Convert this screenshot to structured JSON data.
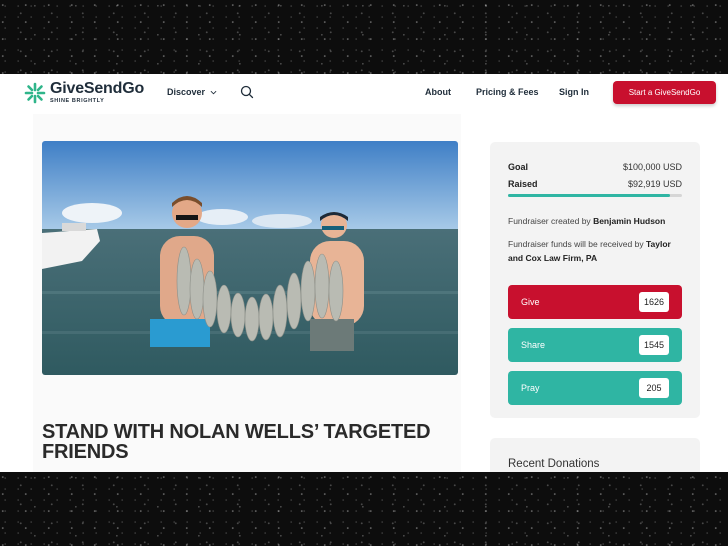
{
  "header": {
    "logo_name": "GiveSendGo",
    "logo_tagline": "SHINE BRIGHTLY",
    "discover_label": "Discover",
    "nav": [
      "About",
      "Pricing & Fees",
      "Sign In"
    ],
    "cta_label": "Start a GiveSendGo"
  },
  "campaign": {
    "title": "STAND WITH NOLAN WELLS’ TARGETED FRIENDS",
    "photo_icon": "photo-two-anglers-with-fish"
  },
  "sidebar": {
    "goal_label": "Goal",
    "goal_value": "$100,000 USD",
    "raised_label": "Raised",
    "raised_value": "$92,919 USD",
    "progress_fraction": 0.929,
    "created_prefix": "Fundraiser created by",
    "created_by": "Benjamin Hudson",
    "received_prefix": "Fundraiser funds will be received by",
    "received_by": "Taylor and Cox Law Firm, PA",
    "actions": [
      {
        "label": "Give",
        "count": "1626",
        "color": "#c8102e"
      },
      {
        "label": "Share",
        "count": "1545",
        "color": "#2fb5a3"
      },
      {
        "label": "Pray",
        "count": "205",
        "color": "#2fb5a3"
      }
    ],
    "recent_donations_label": "Recent Donations"
  },
  "colors": {
    "brand_red": "#c8102e",
    "brand_teal": "#2fb5a3",
    "logo_green": "#2fb58a"
  }
}
